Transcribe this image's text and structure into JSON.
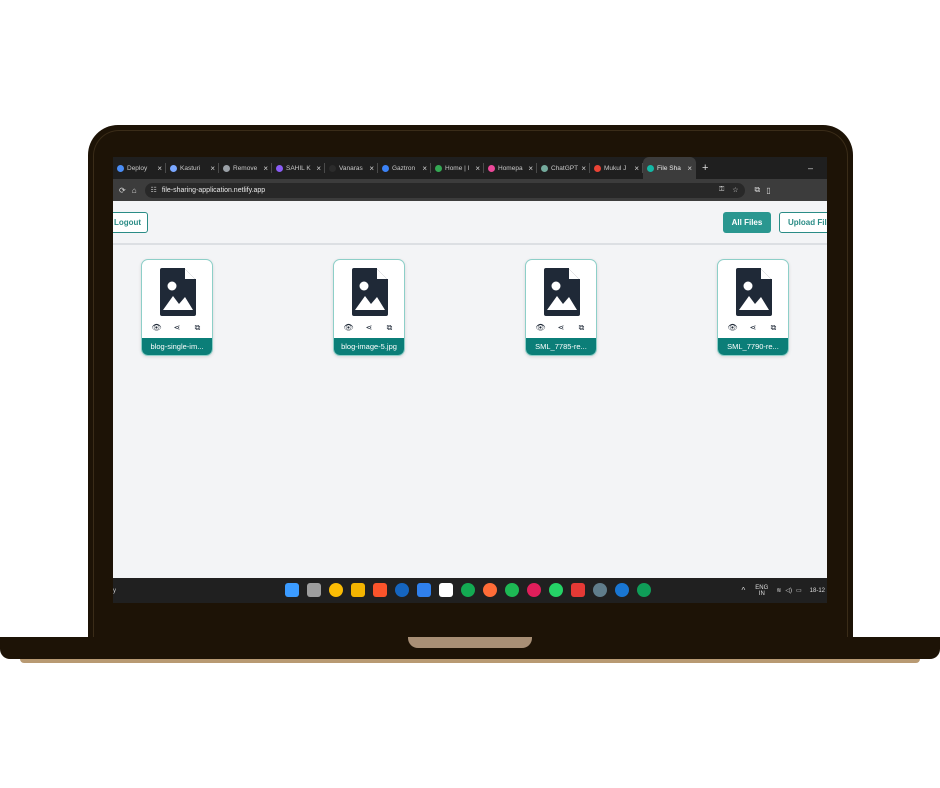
{
  "browser": {
    "tabs": [
      {
        "title": "Deploy",
        "color": "#4a8df6"
      },
      {
        "title": "Kasturi",
        "color": "#7aa7ff"
      },
      {
        "title": "Remove",
        "color": "#9aa0a6"
      },
      {
        "title": "SAHIL K",
        "color": "#8a5cf6"
      },
      {
        "title": "Vanaras",
        "color": "#2b2b2b"
      },
      {
        "title": "Gaztron",
        "color": "#3b82f6"
      },
      {
        "title": "Home | l",
        "color": "#34a853"
      },
      {
        "title": "Homepa",
        "color": "#ec4899"
      },
      {
        "title": "ChatGPT",
        "color": "#74aa9c"
      },
      {
        "title": "Mukul J",
        "color": "#ea4335"
      },
      {
        "title": "File Sha",
        "color": "#14b8a6"
      }
    ],
    "active_tab_index": 10,
    "new_tab_label": "+",
    "minimize_label": "–",
    "url": "file-sharing-application.netlify.app"
  },
  "header": {
    "logout_label": "Logout",
    "all_files_label": "All Files",
    "upload_label": "Upload Fil"
  },
  "files": [
    {
      "name": "blog-single-im..."
    },
    {
      "name": "blog-image-5.jpg"
    },
    {
      "name": "SML_7785-re..."
    },
    {
      "name": "SML_7790-re..."
    }
  ],
  "taskbar": {
    "left_text": "y",
    "language": "ENG",
    "region": "IN",
    "date": "18-12"
  }
}
